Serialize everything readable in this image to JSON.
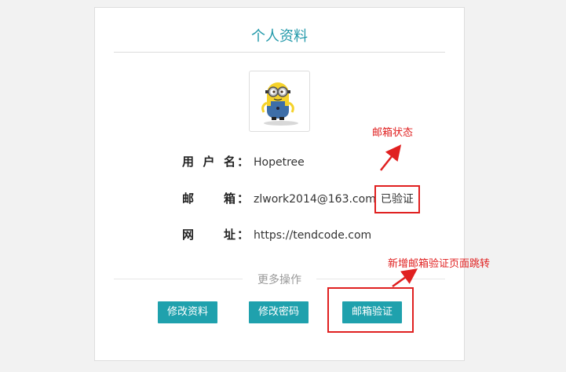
{
  "card": {
    "title": "个人资料"
  },
  "profile": {
    "username_label": "用户名",
    "username_colon": "：",
    "username": "Hopetree",
    "email_label": "邮　箱",
    "email_colon": "：",
    "email": "zlwork2014@163.com",
    "email_status": "已验证",
    "website_label": "网　址",
    "website_colon": "：",
    "website": "https://tendcode.com"
  },
  "more_actions": {
    "label": "更多操作",
    "edit_profile": "修改资料",
    "change_password": "修改密码",
    "email_verify": "邮箱验证"
  },
  "annotations": {
    "status_note": "邮箱状态",
    "new_page_note": "新增邮箱验证页面跳转",
    "color": "#e02020"
  },
  "colors": {
    "accent": "#1fa1ad",
    "title": "#2299aa"
  },
  "icons": {
    "avatar": "minion-avatar"
  }
}
